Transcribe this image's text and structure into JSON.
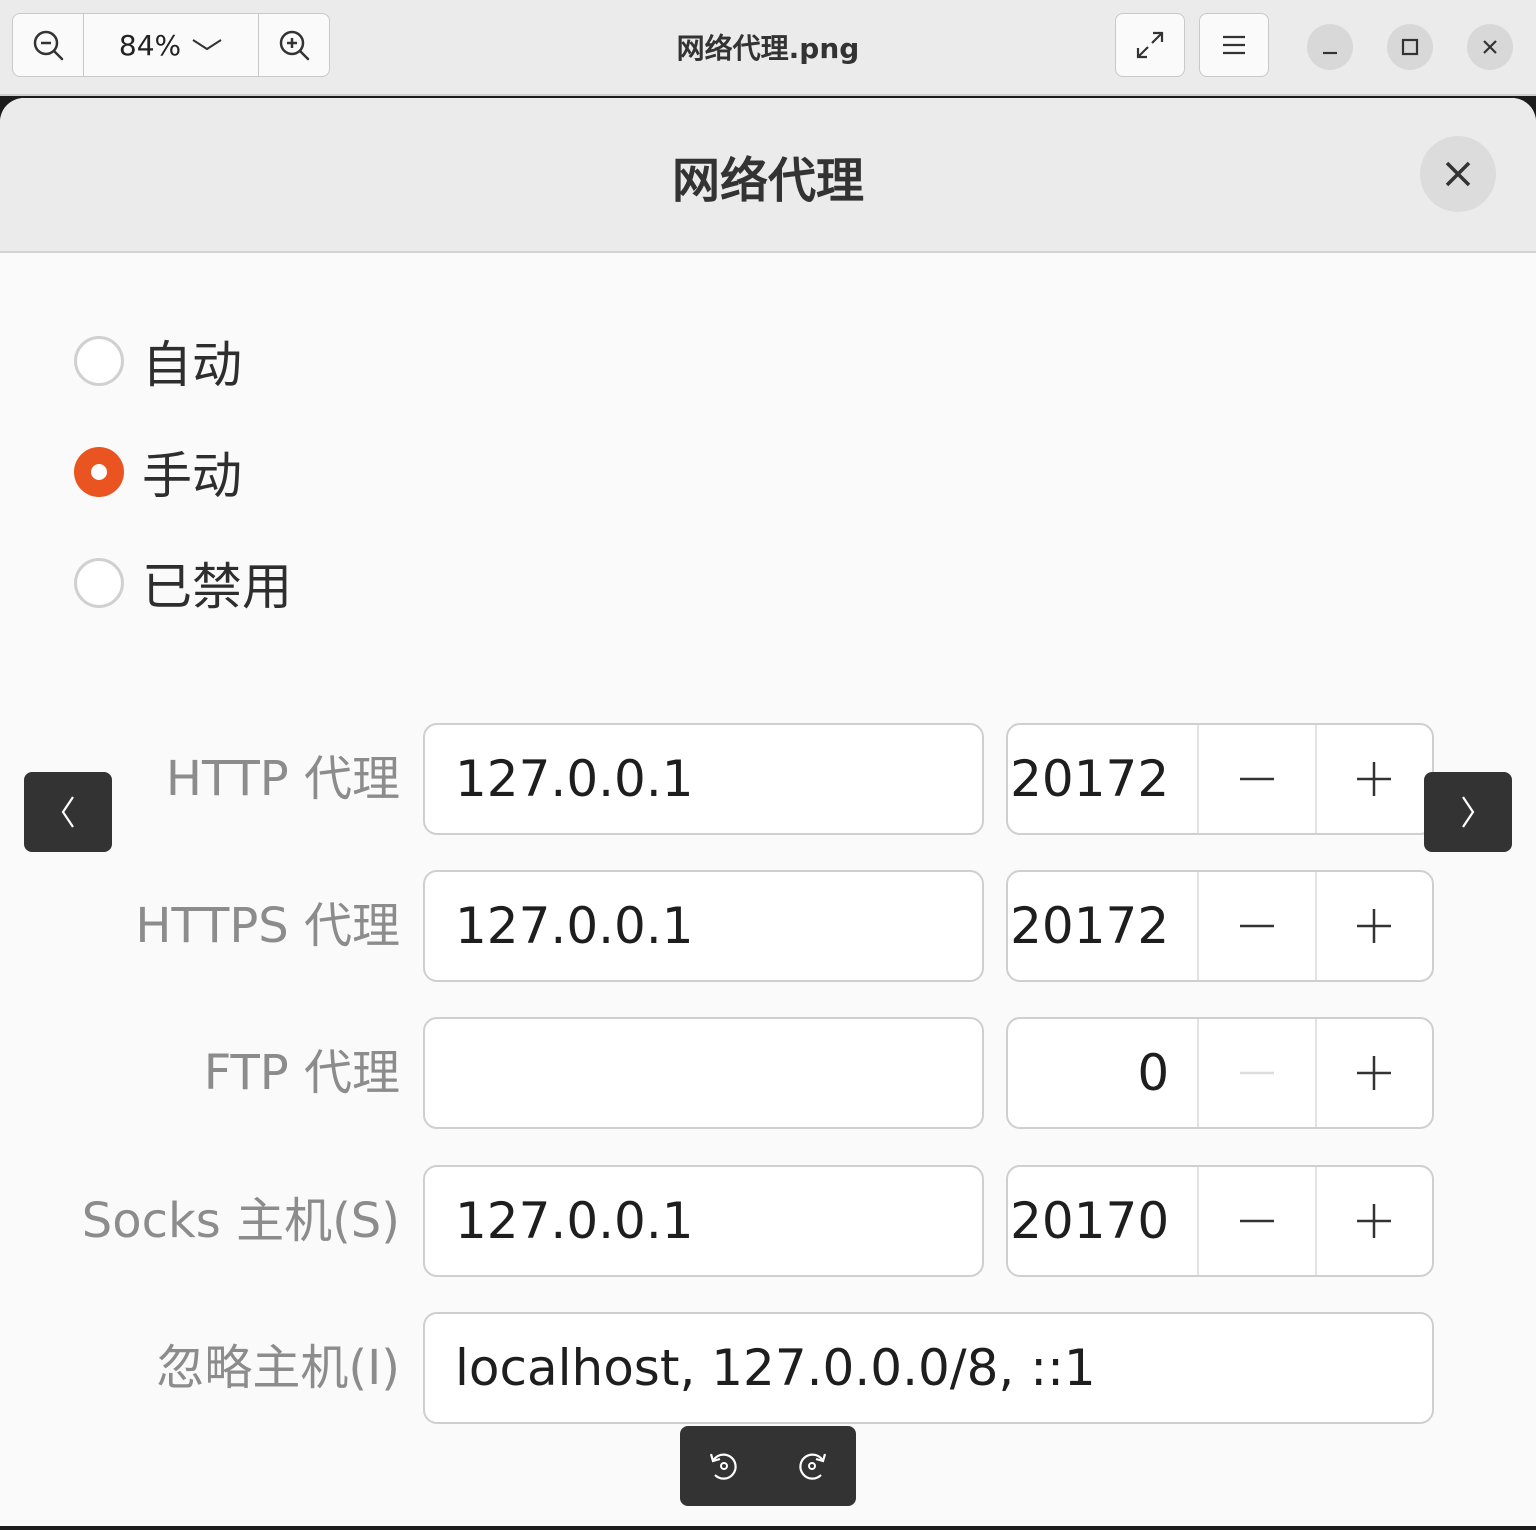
{
  "viewer": {
    "zoom_value": "84%",
    "file_title": "网络代理.png"
  },
  "dialog": {
    "title": "网络代理",
    "modes": [
      {
        "label": "自动",
        "checked": false
      },
      {
        "label": "手动",
        "checked": true
      },
      {
        "label": "已禁用",
        "checked": false
      }
    ],
    "proxies": [
      {
        "label": "HTTP 代理",
        "host": "127.0.0.1",
        "port": "20172",
        "minus_enabled": true
      },
      {
        "label": "HTTPS 代理",
        "host": "127.0.0.1",
        "port": "20172",
        "minus_enabled": true
      },
      {
        "label": "FTP 代理",
        "host": "",
        "port": "0",
        "minus_enabled": false
      },
      {
        "label": "Socks 主机(S)",
        "host": "127.0.0.1",
        "port": "20170",
        "minus_enabled": true
      }
    ],
    "ignore_hosts": {
      "label": "忽略主机(I)",
      "value": "localhost, 127.0.0.0/8, ::1"
    }
  },
  "colors": {
    "accent": "#e95420",
    "overlay_button": "#333333"
  },
  "icons": [
    "zoom-out-icon",
    "chevron-down-icon",
    "zoom-in-icon",
    "fullscreen-icon",
    "menu-icon",
    "minimize-icon",
    "maximize-icon",
    "close-icon",
    "prev-arrow-icon",
    "next-arrow-icon",
    "rotate-left-icon",
    "rotate-right-icon",
    "minus-icon",
    "plus-icon"
  ]
}
